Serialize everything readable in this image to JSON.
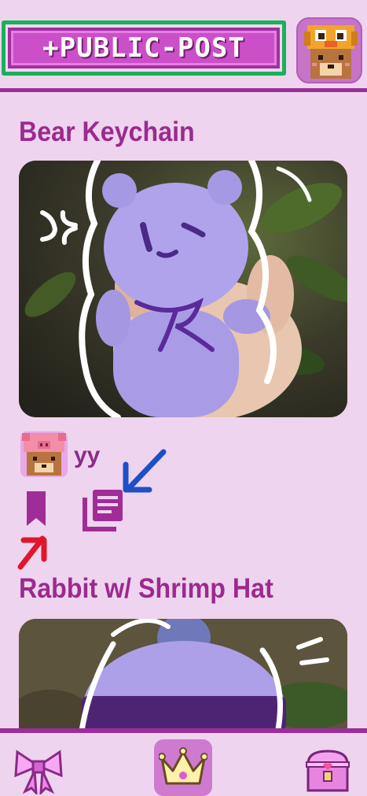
{
  "header": {
    "post_button_label": "+PUBLIC-POST",
    "profile_icon": "duck-hat-bear-icon"
  },
  "feed": {
    "posts": [
      {
        "title": "Bear Keychain",
        "image_icon": "crochet-bear-photo",
        "author": {
          "name": "yy",
          "avatar_icon": "pig-hat-bear-icon"
        },
        "actions": [
          {
            "icon": "bookmark-icon"
          },
          {
            "icon": "library-icon"
          }
        ]
      },
      {
        "title": "Rabbit w/ Shrimp Hat",
        "image_icon": "crochet-rabbit-photo"
      }
    ]
  },
  "bottom_nav": {
    "items": [
      {
        "icon": "bow-icon",
        "active": false
      },
      {
        "icon": "crown-icon",
        "active": true
      },
      {
        "icon": "treasure-chest-icon",
        "active": false
      }
    ]
  },
  "colors": {
    "background": "#eed4ee",
    "accent": "#9b2f98",
    "title": "#9b2a8f",
    "post_button": "#ca4fc8",
    "highlight_green": "#17b25a"
  }
}
